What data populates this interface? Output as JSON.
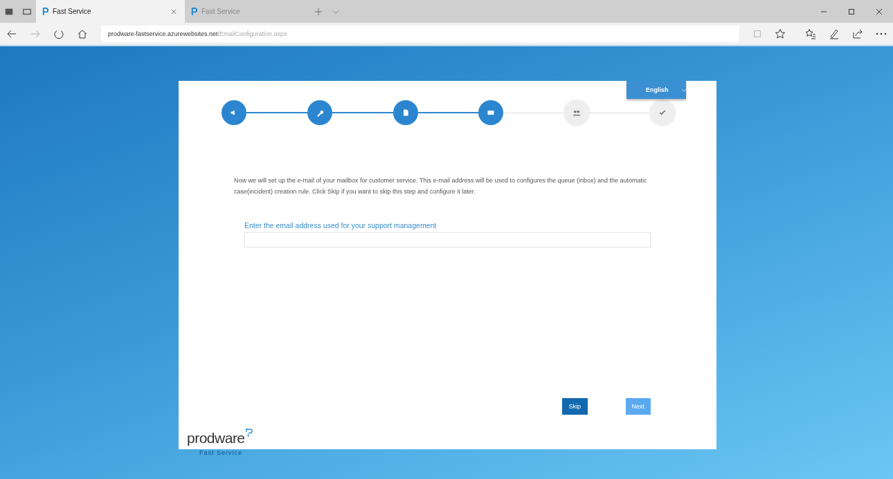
{
  "browser": {
    "tabs": [
      {
        "title": "Fast Service",
        "selected": true
      },
      {
        "title": "Fast Service",
        "selected": false
      }
    ],
    "url_host": "prodware-fastservice.azurewebsites.net",
    "url_path": "/EmailConfiguration.aspx"
  },
  "language": {
    "label": "English"
  },
  "steps": [
    {
      "kind": "speaker",
      "done": true
    },
    {
      "kind": "wrench",
      "done": true
    },
    {
      "kind": "file",
      "done": true
    },
    {
      "kind": "mail",
      "done": true
    },
    {
      "kind": "people",
      "done": false
    },
    {
      "kind": "check",
      "done": false
    }
  ],
  "intro": "Now we will set up the e-mail of your mailbox for customer service. This e-mail address will be used to configures the queue (inbox) and the automatic case(incident) creation rule. Click Skip if you want to skip this step and configure it later.",
  "email_field": {
    "label": "Enter the email address used for your support management"
  },
  "buttons": [
    {
      "label": "Skip",
      "disabled": false
    },
    {
      "label": "Next",
      "disabled": true
    }
  ],
  "logo": {
    "name": "prodware",
    "tagline": "Fast Service"
  }
}
